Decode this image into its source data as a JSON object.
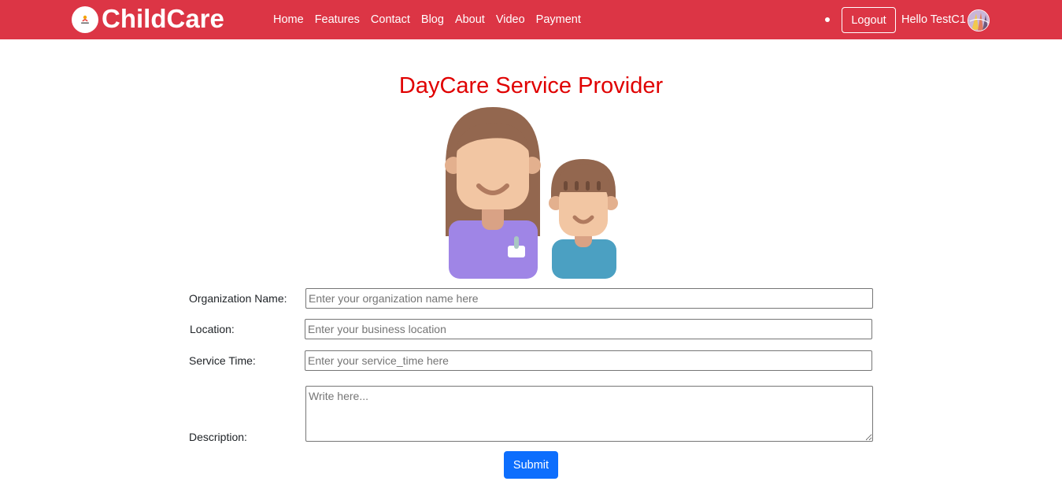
{
  "navbar": {
    "brand": "ChildCare",
    "links": [
      "Home",
      "Features",
      "Contact",
      "Blog",
      "About",
      "Video",
      "Payment"
    ],
    "logout_label": "Logout",
    "greeting": "Hello TestC1",
    "background_color": "#dc3545"
  },
  "main": {
    "title": "DayCare Service Provider",
    "title_color": "#e00000"
  },
  "form": {
    "organization_label": "Organization Name:",
    "organization_placeholder": "Enter your organization name here",
    "location_label": "Location:",
    "location_placeholder": "Enter your business location",
    "service_time_label": "Service Time:",
    "service_time_placeholder": "Enter your service_time here",
    "description_label": "Description:",
    "description_placeholder": "Write here...",
    "submit_label": "Submit",
    "submit_color": "#0d6efd"
  },
  "icons": {
    "brand_logo": "childcare-logo-icon",
    "avatar": "user-avatar-icon",
    "illustration": "caregiver-and-child-illustration"
  }
}
